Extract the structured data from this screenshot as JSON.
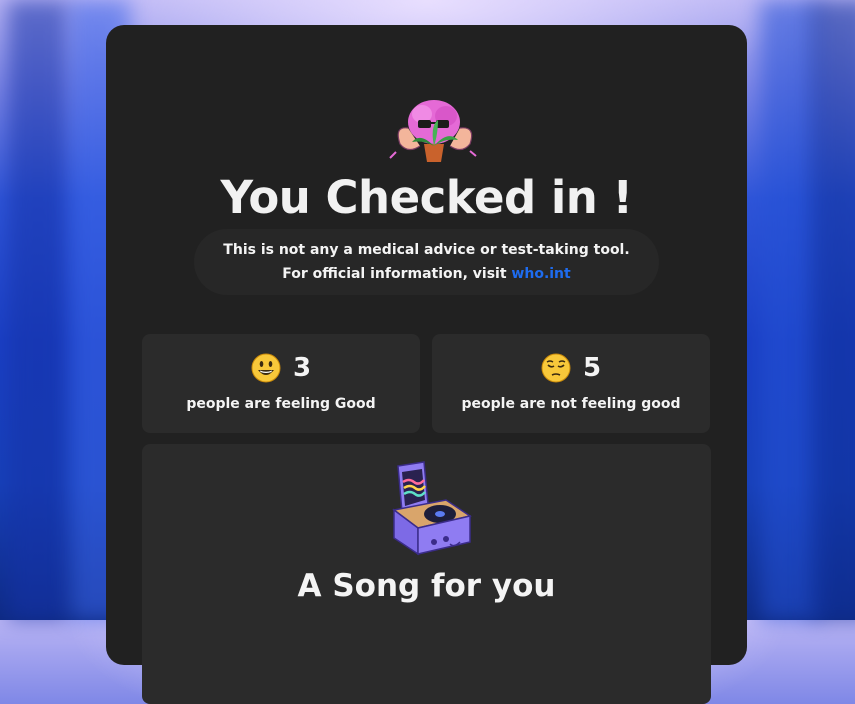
{
  "header": {
    "mascot_icon": "plant-brain-mascot-icon",
    "title": "You Checked in !"
  },
  "notice": {
    "line1": "This is not any a medical advice or test-taking tool.",
    "line2_prefix": "For official information, visit ",
    "link_text": "who.int"
  },
  "stats": {
    "good": {
      "emoji": "grinning-face-icon",
      "count": "3",
      "label": "people are feeling Good"
    },
    "not_good": {
      "emoji": "pensive-face-icon",
      "count": "5",
      "label": "people are not feeling good"
    }
  },
  "song": {
    "icon": "record-player-icon",
    "heading": "A Song for you"
  },
  "colors": {
    "card_bg": "#212121",
    "panel_bg": "#2b2b2b",
    "link": "#1e6cf0",
    "text": "#f4f4f4"
  }
}
